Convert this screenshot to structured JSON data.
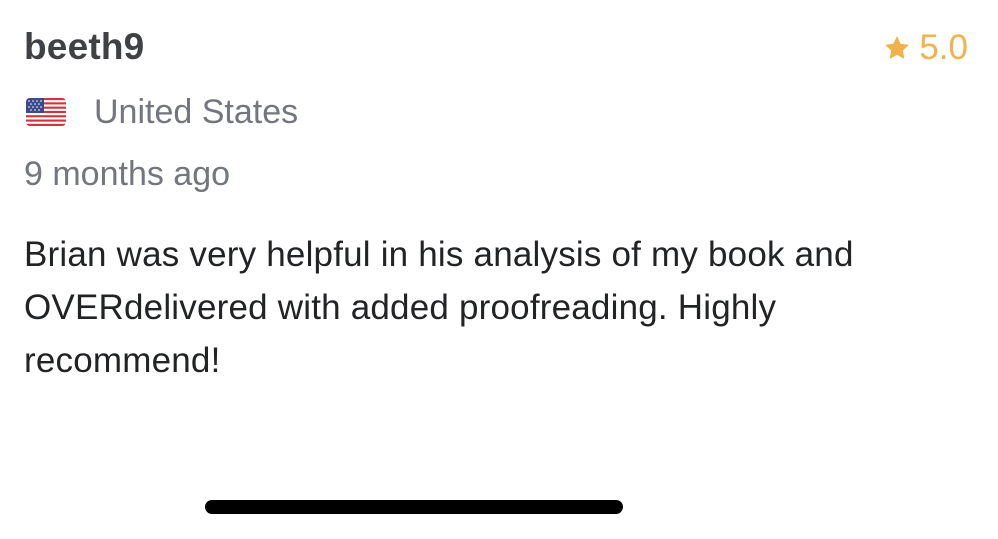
{
  "review": {
    "username": "beeth9",
    "rating": "5.0",
    "country": "United States",
    "country_flag_icon": "us-flag-icon",
    "time_ago": "9 months ago",
    "text": "Brian was very helpful in his analysis of my book and OVERdelivered with added proofreading. Highly recommend!"
  },
  "colors": {
    "star": "#f2b24a",
    "username": "#404145",
    "secondary_text": "#74767e",
    "body_text": "#222325"
  }
}
